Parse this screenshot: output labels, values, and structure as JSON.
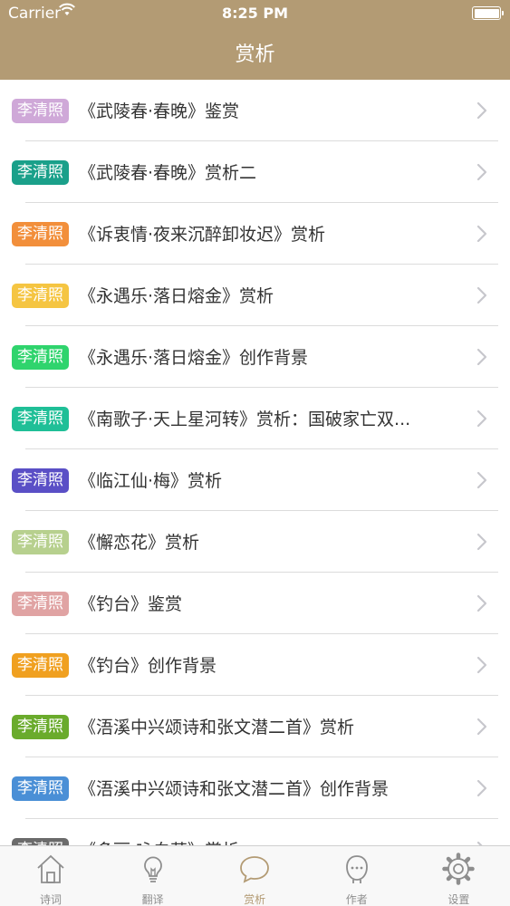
{
  "status_bar": {
    "carrier": "Carrier",
    "time": "8:25 PM"
  },
  "nav": {
    "title": "赏析"
  },
  "list": [
    {
      "author": "李清照",
      "title": "《武陵春·春晚》鉴赏",
      "color": "#cfa8d8"
    },
    {
      "author": "李清照",
      "title": "《武陵春·春晚》赏析二",
      "color": "#1aa08a"
    },
    {
      "author": "李清照",
      "title": "《诉衷情·夜来沉醉卸妆迟》赏析",
      "color": "#f28f3b"
    },
    {
      "author": "李清照",
      "title": "《永遇乐·落日熔金》赏析",
      "color": "#f5c542"
    },
    {
      "author": "李清照",
      "title": "《永遇乐·落日熔金》创作背景",
      "color": "#2fd46d"
    },
    {
      "author": "李清照",
      "title": "《南歌子·天上星河转》赏析：国破家亡双...",
      "color": "#1fbf97"
    },
    {
      "author": "李清照",
      "title": "《临江仙·梅》赏析",
      "color": "#5a4fc6"
    },
    {
      "author": "李清照",
      "title": "《懈恋花》赏析",
      "color": "#b7d08e"
    },
    {
      "author": "李清照",
      "title": "《钓台》鉴赏",
      "color": "#e0a3a3"
    },
    {
      "author": "李清照",
      "title": "《钓台》创作背景",
      "color": "#f0a020"
    },
    {
      "author": "李清照",
      "title": "《浯溪中兴颂诗和张文潜二首》赏析",
      "color": "#6aab2c"
    },
    {
      "author": "李清照",
      "title": "《浯溪中兴颂诗和张文潜二首》创作背景",
      "color": "#4a8fd6"
    },
    {
      "author": "李清照",
      "title": "《多丽·咏白菊》赏析",
      "color": "#6b6b6b"
    }
  ],
  "tabs": [
    {
      "label": "诗词",
      "icon": "house-icon",
      "active": false
    },
    {
      "label": "翻译",
      "icon": "lightbulb-icon",
      "active": false
    },
    {
      "label": "赏析",
      "icon": "speech-bubble-icon",
      "active": true
    },
    {
      "label": "作者",
      "icon": "person-icon",
      "active": false
    },
    {
      "label": "设置",
      "icon": "gear-icon",
      "active": false
    }
  ],
  "colors": {
    "header": "#b39b74",
    "tab_active": "#b39b74",
    "tab_inactive": "#8e8e8e"
  }
}
